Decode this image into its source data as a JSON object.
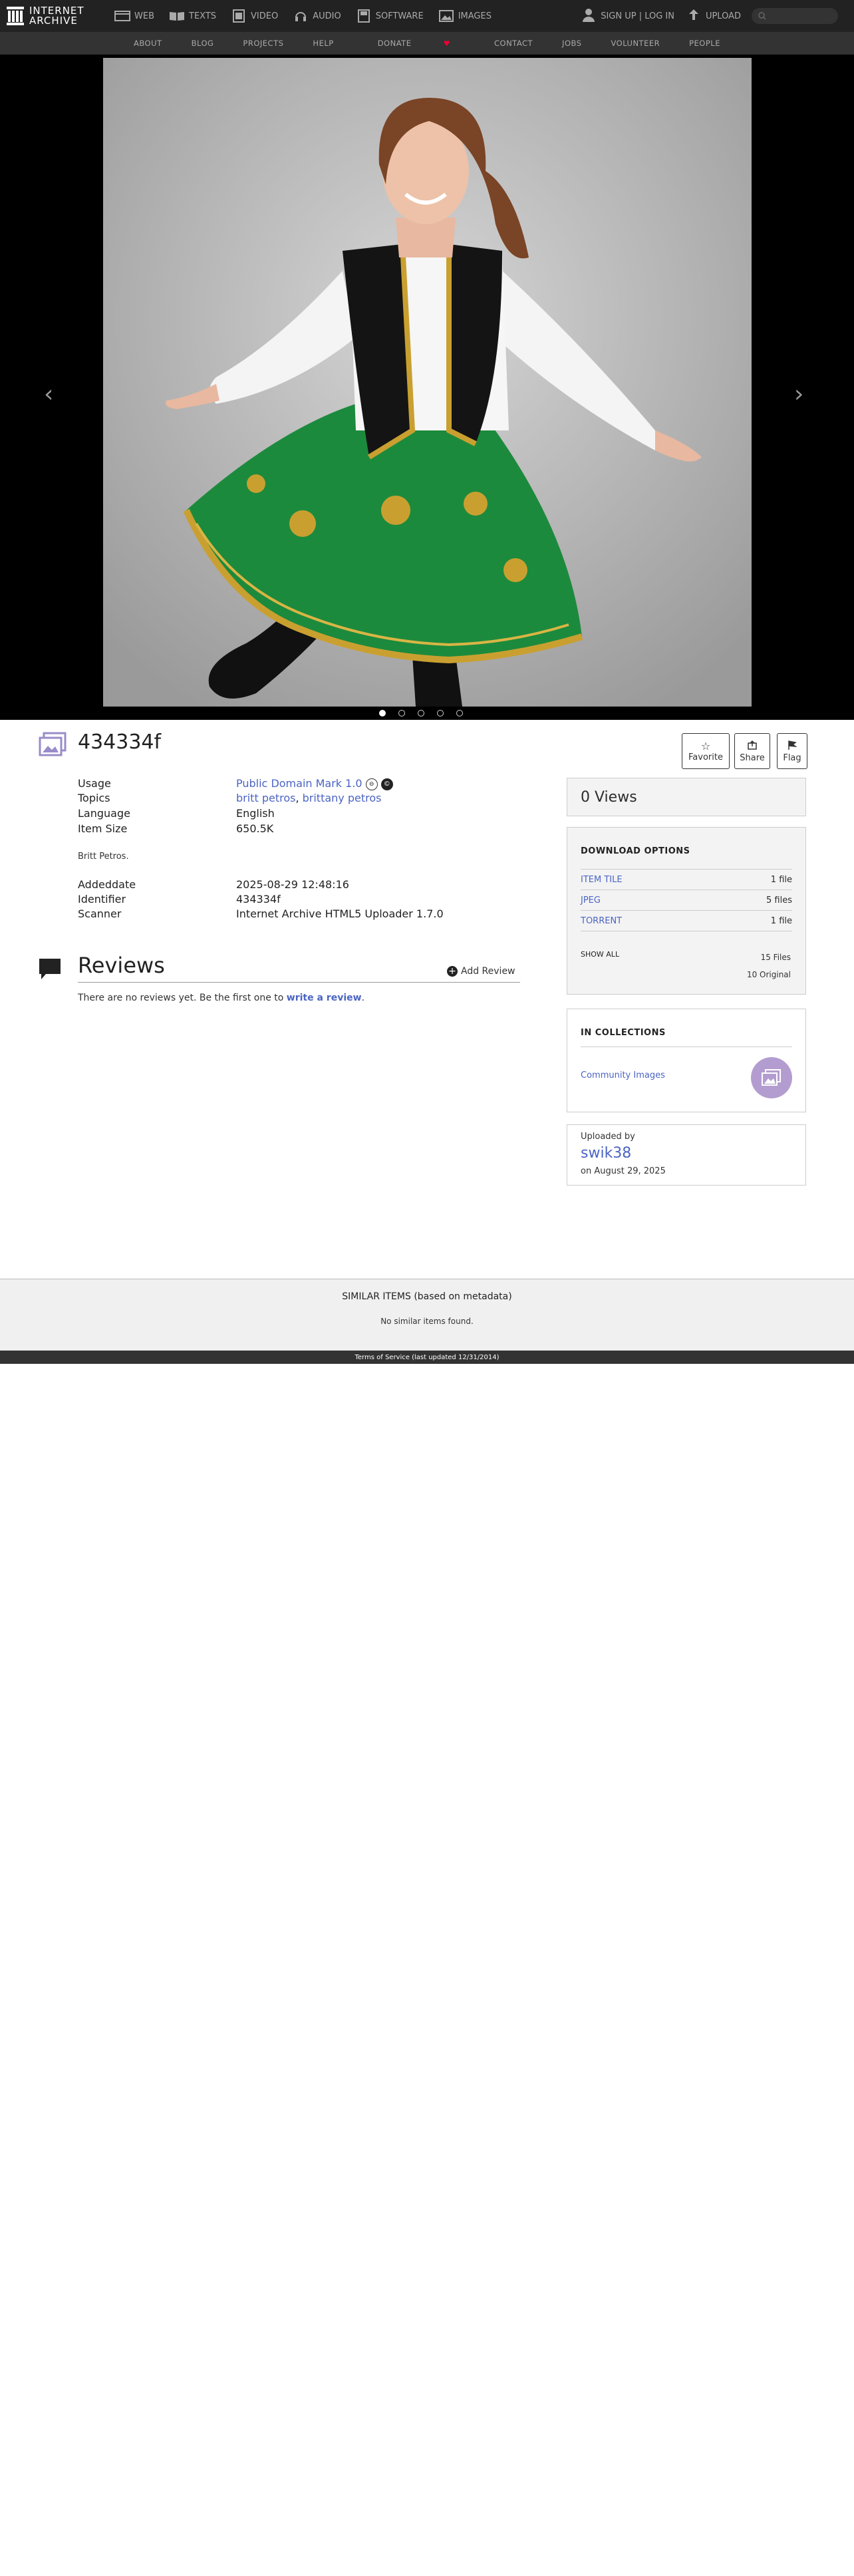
{
  "brand": {
    "line1": "INTERNET",
    "line2": "ARCHIVE"
  },
  "topnav": {
    "media": [
      {
        "label": "WEB",
        "icon": "web-icon"
      },
      {
        "label": "TEXTS",
        "icon": "texts-icon"
      },
      {
        "label": "VIDEO",
        "icon": "video-icon"
      },
      {
        "label": "AUDIO",
        "icon": "audio-icon"
      },
      {
        "label": "SOFTWARE",
        "icon": "software-icon"
      },
      {
        "label": "IMAGES",
        "icon": "images-icon"
      }
    ],
    "user_label": "SIGN UP | LOG IN",
    "upload_label": "UPLOAD"
  },
  "subnav": [
    "ABOUT",
    "BLOG",
    "PROJECTS",
    "HELP",
    "DONATE",
    "CONTACT",
    "JOBS",
    "VOLUNTEER",
    "PEOPLE"
  ],
  "theater": {
    "slide_count": 5,
    "active_slide": 1
  },
  "item": {
    "title": "434334f",
    "actions": {
      "favorite": "Favorite",
      "share": "Share",
      "flag": "Flag"
    },
    "metadata": {
      "usage_key": "Usage",
      "usage_val": "Public Domain Mark 1.0",
      "topics_key": "Topics",
      "topic1": "britt petros",
      "topic_sep": ", ",
      "topic2": "brittany petros",
      "language_key": "Language",
      "language_val": "English",
      "size_key": "Item Size",
      "size_val": "650.5K",
      "description": "Britt Petros.",
      "added_key": "Addeddate",
      "added_val": "2025-08-29 12:48:16",
      "identifier_key": "Identifier",
      "identifier_val": "434334f",
      "scanner_key": "Scanner",
      "scanner_val": "Internet Archive HTML5 Uploader 1.7.0"
    }
  },
  "reviews": {
    "title": "Reviews",
    "add_label": "Add Review",
    "empty_text": "There are no reviews yet. Be the first one to ",
    "write_link": "write a review",
    "end": "."
  },
  "sidebar": {
    "views": "0 Views",
    "download_title": "DOWNLOAD OPTIONS",
    "downloads": [
      {
        "label": "ITEM TILE",
        "count": "1 file"
      },
      {
        "label": "JPEG",
        "count": "5 files"
      },
      {
        "label": "TORRENT",
        "count": "1 file"
      }
    ],
    "show_all": "SHOW ALL",
    "total_files": "15 Files",
    "original": "10 Original",
    "collections_title": "IN COLLECTIONS",
    "collection_name": "Community Images",
    "uploaded_by": "Uploaded by",
    "uploader": "swik38",
    "upload_date": "on August 29, 2025"
  },
  "similar": {
    "title": "SIMILAR ITEMS (based on metadata)",
    "empty": "No similar items found."
  },
  "footer": {
    "terms": "Terms of Service (last updated 12/31/2014)"
  },
  "colors": {
    "accent": "#4b64c4",
    "topnav": "#222222",
    "subnav": "#333333",
    "collection_badge": "#b39dd0"
  }
}
